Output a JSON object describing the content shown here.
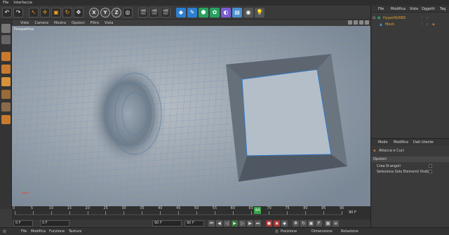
{
  "menubar": {
    "items": [
      "File",
      "Interfaccia"
    ]
  },
  "toolbar": {
    "axis_x": "X",
    "axis_y": "Y",
    "axis_z": "Z"
  },
  "viewport": {
    "menu": [
      "Viste",
      "Camera",
      "Mostra",
      "Opzioni",
      "Filtro",
      "Vista"
    ],
    "label": "Prospettiva"
  },
  "timeline": {
    "ticks": [
      "0",
      "5",
      "10",
      "15",
      "20",
      "25",
      "30",
      "35",
      "40",
      "45",
      "50",
      "55",
      "60",
      "65",
      "70",
      "75",
      "80",
      "85",
      "90"
    ],
    "frame_end_label": "90 F",
    "current_frame_label": "64",
    "start_field": "0 F",
    "start_field2": "0 F",
    "end_field": "90 F",
    "end_field2": "90 F"
  },
  "bottom": {
    "items": [
      "File",
      "Modifica",
      "Funzione",
      "Texture"
    ],
    "coords": [
      "Posizione",
      "Dimensione",
      "Rotazione"
    ]
  },
  "object_manager": {
    "menu": [
      "File",
      "Modifica",
      "Viste",
      "Oggetti",
      "Tag"
    ],
    "objects": [
      {
        "name": "HyperNURBS",
        "color": "#e0a030"
      },
      {
        "name": "Mesh",
        "color": "#e0a030"
      }
    ]
  },
  "attribute_manager": {
    "menu": [
      "Modo",
      "Modifica",
      "Dati Utente"
    ],
    "tool_name": "Attacca e Cuci",
    "section": "Opzioni",
    "options": [
      "Crea N-angoli",
      "Seleziona Solo Elementi Visibili"
    ]
  },
  "colors": {
    "accent_orange": "#e08a20",
    "viewport_bg": "#8d98a3",
    "wire": "#2f78c8"
  }
}
